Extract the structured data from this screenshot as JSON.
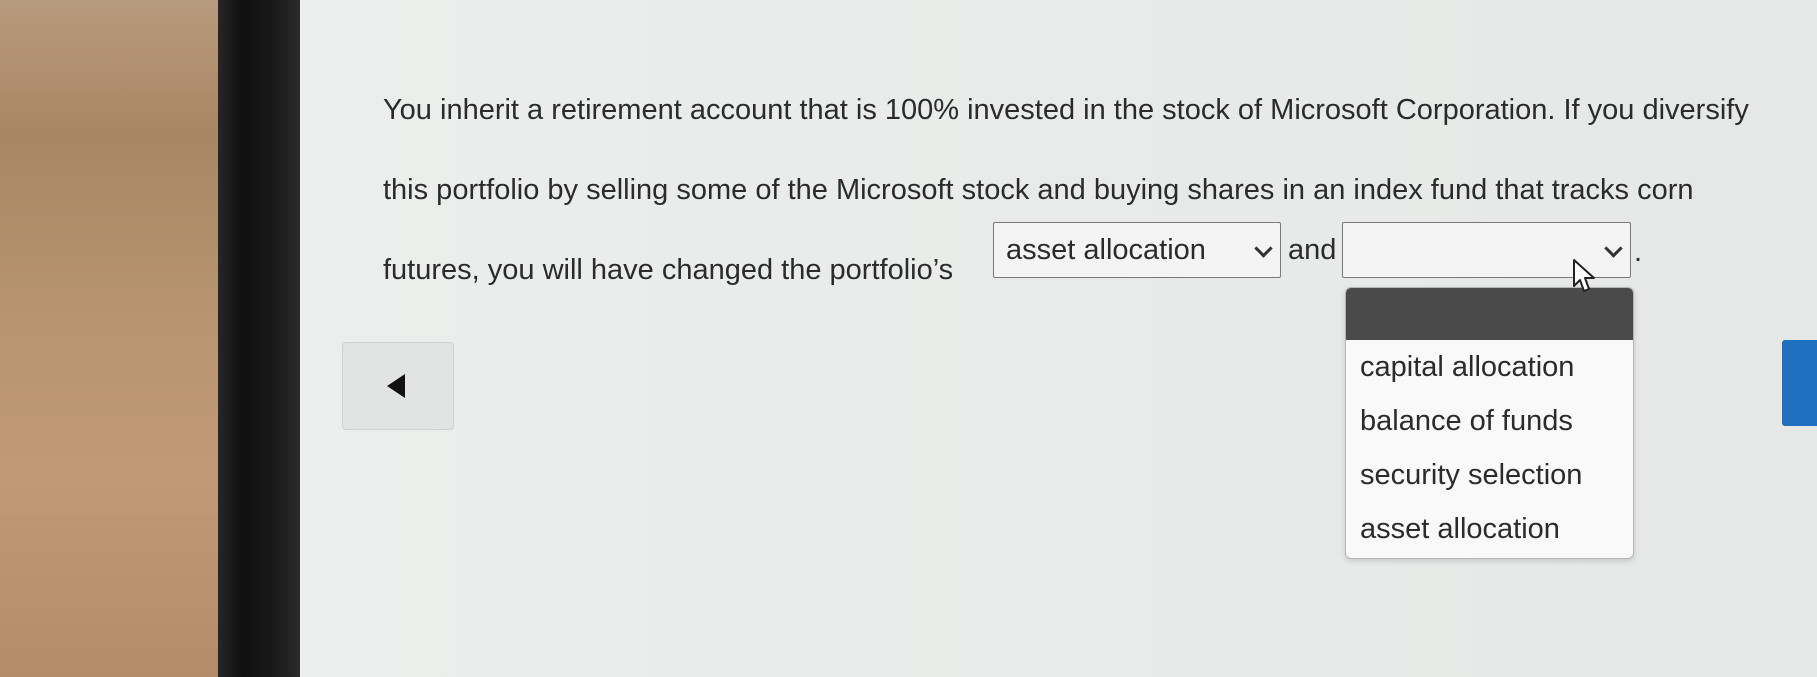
{
  "question": {
    "line1": "You inherit a retirement account that is 100% invested in the stock of Microsoft Corporation. If you diversify",
    "line2": "this portfolio by selling some of the Microsoft stock and buying shares in an index fund that tracks corn",
    "line3_prefix": "futures, you will have changed the portfolio’s",
    "connector": "and",
    "suffix": "."
  },
  "select1": {
    "value": "asset allocation"
  },
  "select2": {
    "value": ""
  },
  "dropdown": {
    "options": [
      "capital allocation",
      "balance of funds",
      "security selection",
      "asset allocation"
    ]
  },
  "icons": {
    "back": "triangle-left-icon",
    "select_chevron": "chevron-down-icon",
    "cursor": "mouse-pointer-icon"
  },
  "colors": {
    "accent": "#1f6fbf",
    "text": "#2b2b2b",
    "dropdown_header": "#4a4a4a"
  }
}
